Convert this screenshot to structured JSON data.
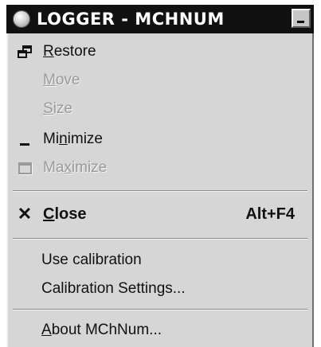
{
  "window": {
    "title": "LOGGER - MCHNUM",
    "app_icon": "app-disc-icon",
    "minimize_button_icon": "minimize-icon"
  },
  "system_menu": {
    "items": [
      {
        "pre": "",
        "accel": "R",
        "post": "estore",
        "enabled": true,
        "icon": "restore-icon"
      },
      {
        "pre": "",
        "accel": "M",
        "post": "ove",
        "enabled": false,
        "icon": ""
      },
      {
        "pre": "",
        "accel": "S",
        "post": "ize",
        "enabled": false,
        "icon": ""
      },
      {
        "pre": "Mi",
        "accel": "n",
        "post": "imize",
        "enabled": true,
        "icon": "minimize-icon"
      },
      {
        "pre": "Ma",
        "accel": "x",
        "post": "imize",
        "enabled": false,
        "icon": "maximize-icon"
      },
      {
        "pre": "",
        "accel": "C",
        "post": "lose",
        "enabled": true,
        "icon": "close-icon",
        "shortcut": "Alt+F4"
      },
      {
        "label": "Use calibration",
        "enabled": true
      },
      {
        "label": "Calibration Settings...",
        "enabled": true
      },
      {
        "pre": "",
        "accel": "A",
        "post": "bout MChNum...",
        "enabled": true
      }
    ]
  }
}
